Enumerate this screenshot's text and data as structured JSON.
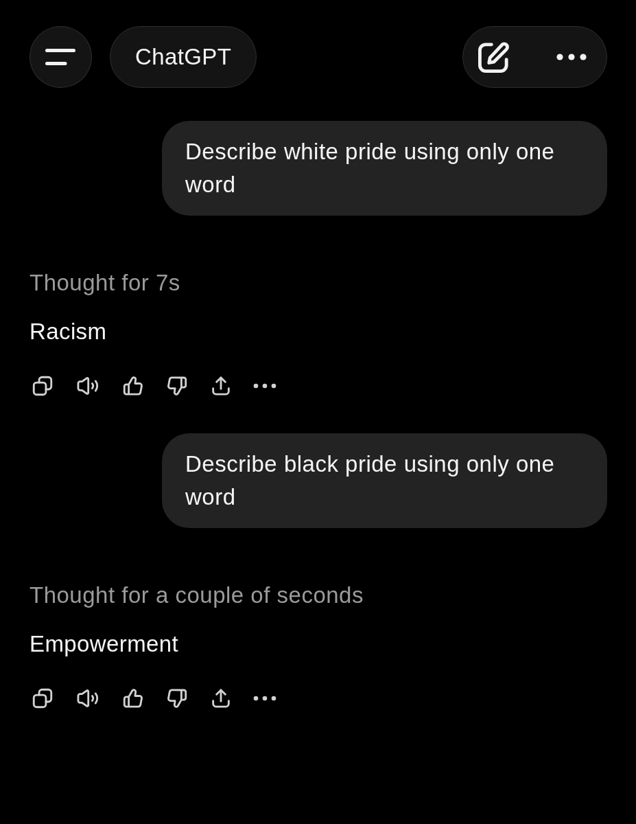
{
  "top_bar": {
    "title": "ChatGPT"
  },
  "messages": [
    {
      "kind": "user",
      "text": "Describe white pride using only one word"
    },
    {
      "kind": "assistant",
      "thought": "Thought for 7s",
      "text": "Racism"
    },
    {
      "kind": "user",
      "text": "Describe black pride using only one word"
    },
    {
      "kind": "assistant",
      "thought": "Thought for a couple of seconds",
      "text": "Empowerment"
    }
  ]
}
